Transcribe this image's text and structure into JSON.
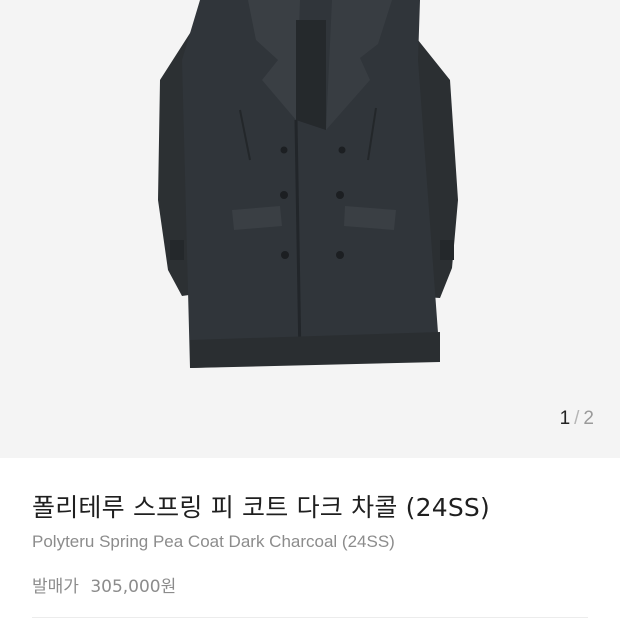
{
  "carousel": {
    "current": "1",
    "separator": "/",
    "total": "2",
    "image_subject": "coat-photo"
  },
  "product": {
    "title_ko": "폴리테루 스프링 피 코트 다크 차콜 (24SS)",
    "title_en": "Polyteru Spring Pea Coat Dark Charcoal (24SS)",
    "price_label": "발매가",
    "price_value": "305,000원"
  },
  "colors": {
    "image_bg": "#f4f4f4",
    "coat": "#2f3336",
    "title": "#1f1f1f",
    "muted": "#8c8c8c"
  }
}
